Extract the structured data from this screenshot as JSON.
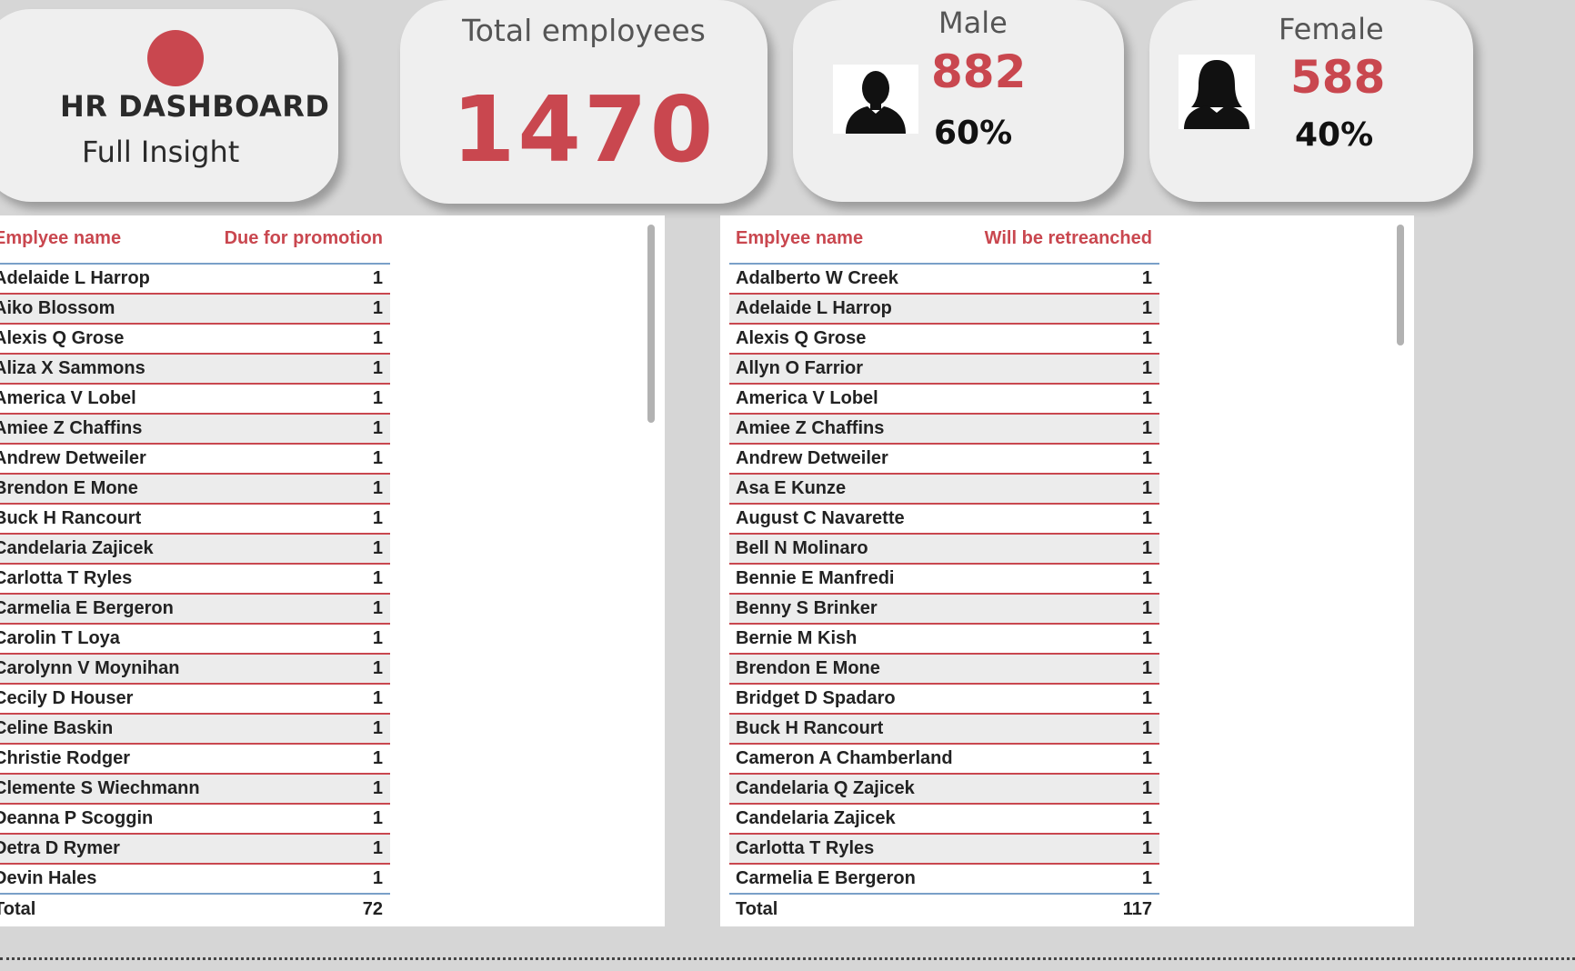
{
  "header": {
    "title": "HR DASHBOARD",
    "subtitle": "Full Insight",
    "accent_color": "#c9474f"
  },
  "total": {
    "label": "Total employees",
    "value": "1470"
  },
  "male": {
    "label": "Male",
    "count": "882",
    "percent": "60%",
    "icon": "male-person-icon"
  },
  "female": {
    "label": "Female",
    "count": "588",
    "percent": "40%",
    "icon": "female-person-icon"
  },
  "promotion_table": {
    "col_name": "Emplyee name",
    "col_value": "Due for promotion",
    "rows": [
      {
        "name": "Adelaide L Harrop",
        "value": "1"
      },
      {
        "name": "Aiko Blossom",
        "value": "1"
      },
      {
        "name": "Alexis Q Grose",
        "value": "1"
      },
      {
        "name": "Aliza X Sammons",
        "value": "1"
      },
      {
        "name": "America V Lobel",
        "value": "1"
      },
      {
        "name": "Amiee Z Chaffins",
        "value": "1"
      },
      {
        "name": "Andrew Detweiler",
        "value": "1"
      },
      {
        "name": "Brendon E Mone",
        "value": "1"
      },
      {
        "name": "Buck H Rancourt",
        "value": "1"
      },
      {
        "name": "Candelaria Zajicek",
        "value": "1"
      },
      {
        "name": "Carlotta T Ryles",
        "value": "1"
      },
      {
        "name": "Carmelia E Bergeron",
        "value": "1"
      },
      {
        "name": "Carolin T Loya",
        "value": "1"
      },
      {
        "name": "Carolynn V Moynihan",
        "value": "1"
      },
      {
        "name": "Cecily D Houser",
        "value": "1"
      },
      {
        "name": "Celine Baskin",
        "value": "1"
      },
      {
        "name": "Christie Rodger",
        "value": "1"
      },
      {
        "name": "Clemente S Wiechmann",
        "value": "1"
      },
      {
        "name": "Deanna P Scoggin",
        "value": "1"
      },
      {
        "name": "Detra D Rymer",
        "value": "1"
      },
      {
        "name": "Devin Hales",
        "value": "1"
      }
    ],
    "total_label": "Total",
    "total_value": "72"
  },
  "retrench_table": {
    "col_name": "Emplyee name",
    "col_value": "Will be retreanched",
    "rows": [
      {
        "name": "Adalberto W Creek",
        "value": "1"
      },
      {
        "name": "Adelaide L Harrop",
        "value": "1"
      },
      {
        "name": "Alexis Q Grose",
        "value": "1"
      },
      {
        "name": "Allyn O Farrior",
        "value": "1"
      },
      {
        "name": "America V Lobel",
        "value": "1"
      },
      {
        "name": "Amiee Z Chaffins",
        "value": "1"
      },
      {
        "name": "Andrew Detweiler",
        "value": "1"
      },
      {
        "name": "Asa E Kunze",
        "value": "1"
      },
      {
        "name": "August C Navarette",
        "value": "1"
      },
      {
        "name": "Bell N Molinaro",
        "value": "1"
      },
      {
        "name": "Bennie E Manfredi",
        "value": "1"
      },
      {
        "name": "Benny S Brinker",
        "value": "1"
      },
      {
        "name": "Bernie M Kish",
        "value": "1"
      },
      {
        "name": "Brendon E Mone",
        "value": "1"
      },
      {
        "name": "Bridget D Spadaro",
        "value": "1"
      },
      {
        "name": "Buck H Rancourt",
        "value": "1"
      },
      {
        "name": "Cameron A Chamberland",
        "value": "1"
      },
      {
        "name": "Candelaria Q Zajicek",
        "value": "1"
      },
      {
        "name": "Candelaria Zajicek",
        "value": "1"
      },
      {
        "name": "Carlotta T Ryles",
        "value": "1"
      },
      {
        "name": "Carmelia E Bergeron",
        "value": "1"
      }
    ],
    "total_label": "Total",
    "total_value": "117"
  }
}
